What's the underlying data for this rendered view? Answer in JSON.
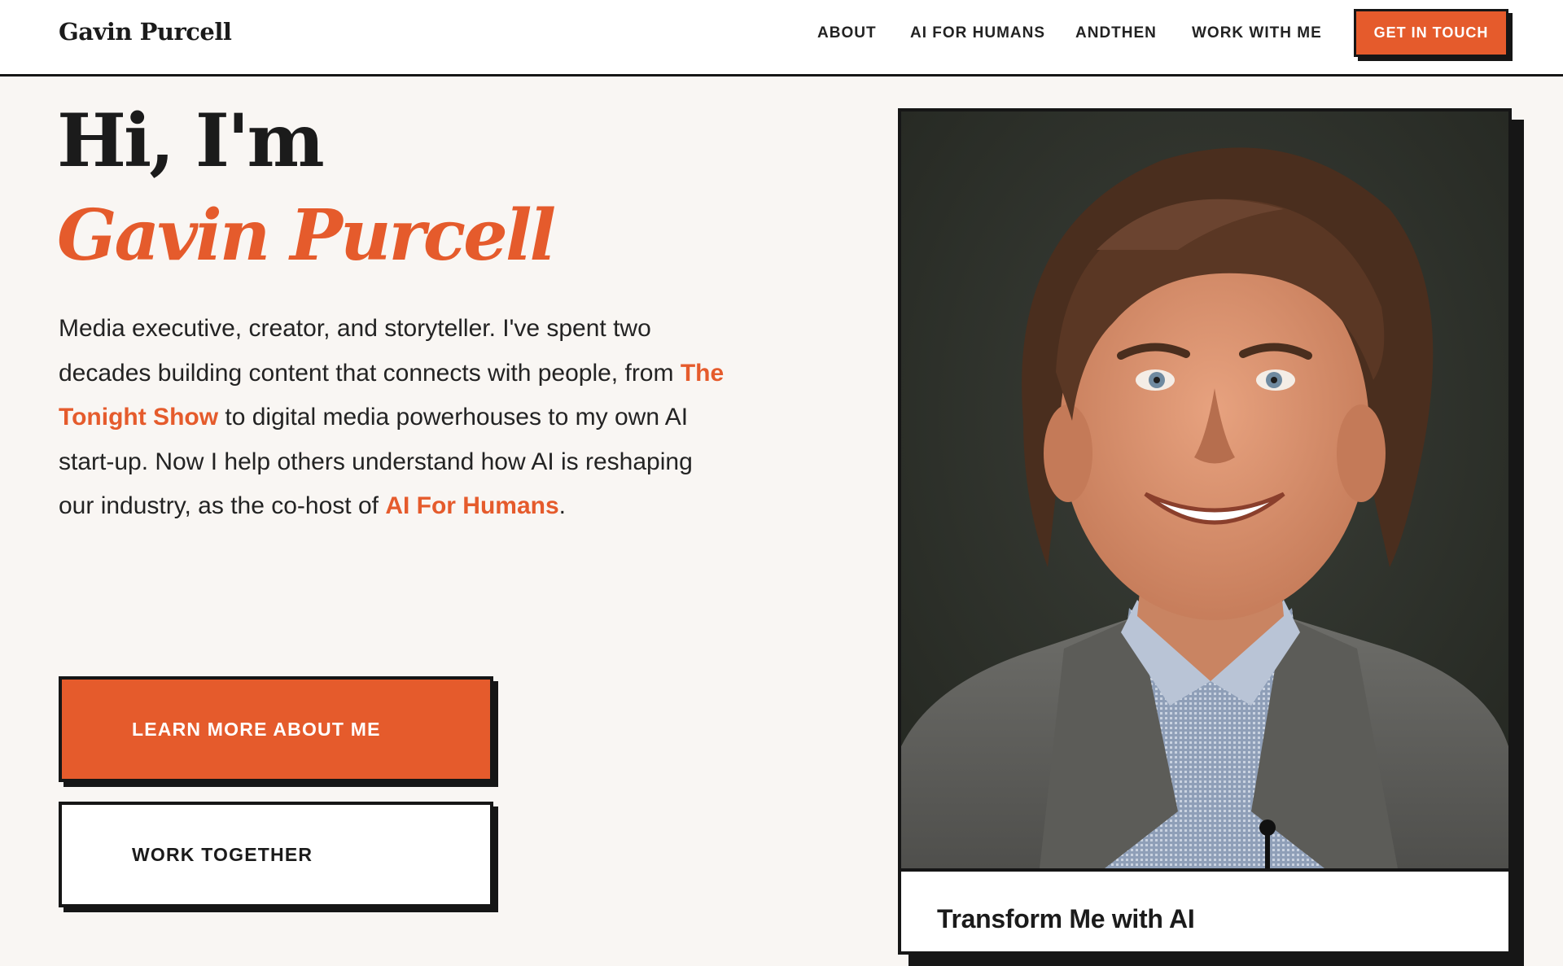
{
  "header": {
    "brand": "Gavin Purcell",
    "nav": [
      {
        "label": "ABOUT"
      },
      {
        "label": "AI FOR HUMANS"
      },
      {
        "label": "ANDTHEN"
      },
      {
        "label": "WORK WITH ME"
      }
    ],
    "cta_label": "GET IN TOUCH"
  },
  "hero": {
    "greeting": "Hi, I'm",
    "name": "Gavin Purcell",
    "bio": {
      "part1": "Media executive, creator, and storyteller. I've spent two decades building content that connects with people, from ",
      "link1": "The Tonight Show",
      "part2": " to digital media powerhouses to my own AI start-up. Now I help others understand how AI is reshaping our industry, as the co-host of ",
      "link2": "AI For Humans",
      "part3": "."
    },
    "primary_button": "LEARN MORE ABOUT ME",
    "secondary_button": "WORK TOGETHER"
  },
  "card": {
    "title": "Transform Me with AI"
  },
  "colors": {
    "accent": "#e55b2c",
    "ink": "#161616",
    "background": "#f9f6f3"
  }
}
